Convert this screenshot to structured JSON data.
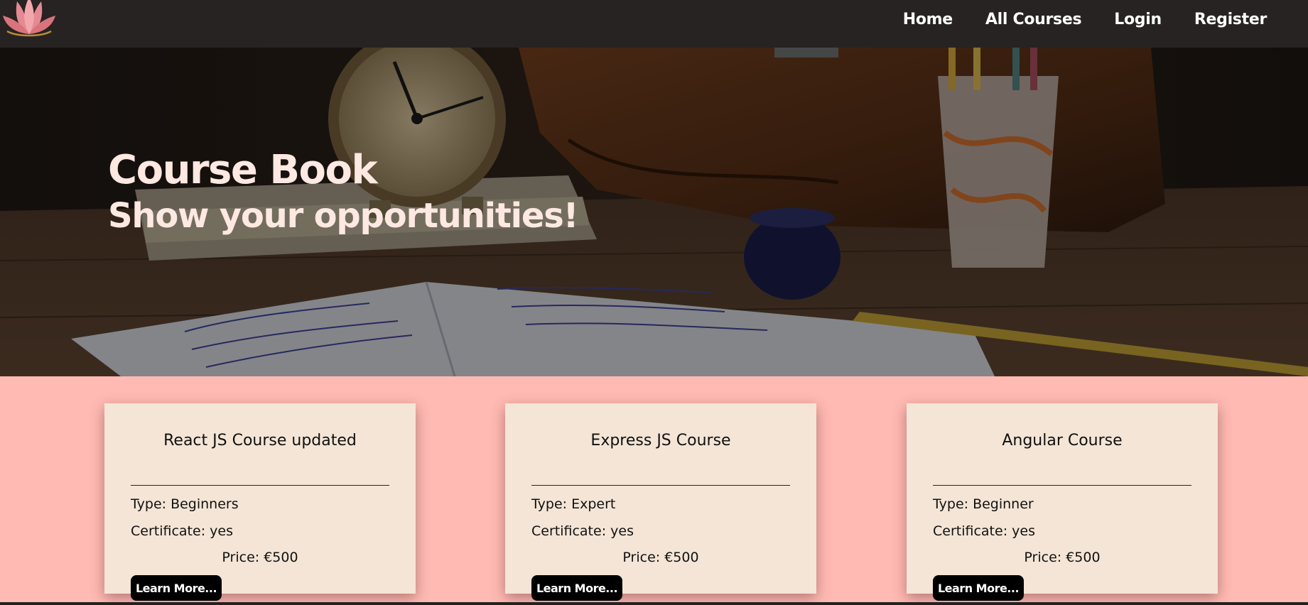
{
  "nav": {
    "logo_icon": "lotus-logo-icon",
    "links": [
      "Home",
      "All Courses",
      "Login",
      "Register"
    ]
  },
  "hero": {
    "title": "Course Book",
    "subtitle": "Show your opportunities!"
  },
  "courses": [
    {
      "title": "React JS Course updated",
      "type": "Type: Beginners",
      "certificate": "Certificate: yes",
      "price": "Price: €500",
      "button": "Learn More..."
    },
    {
      "title": "Express JS Course",
      "type": "Type: Expert",
      "certificate": "Certificate: yes",
      "price": "Price: €500",
      "button": "Learn More..."
    },
    {
      "title": "Angular Course",
      "type": "Type: Beginner",
      "certificate": "Certificate: yes",
      "price": "Price: €500",
      "button": "Learn More..."
    }
  ],
  "colors": {
    "navbar": "#262322",
    "page_background": "#ffbab3",
    "card_background": "#f4e5d6",
    "button": "#000000",
    "hero_text": "#fde8e2"
  }
}
